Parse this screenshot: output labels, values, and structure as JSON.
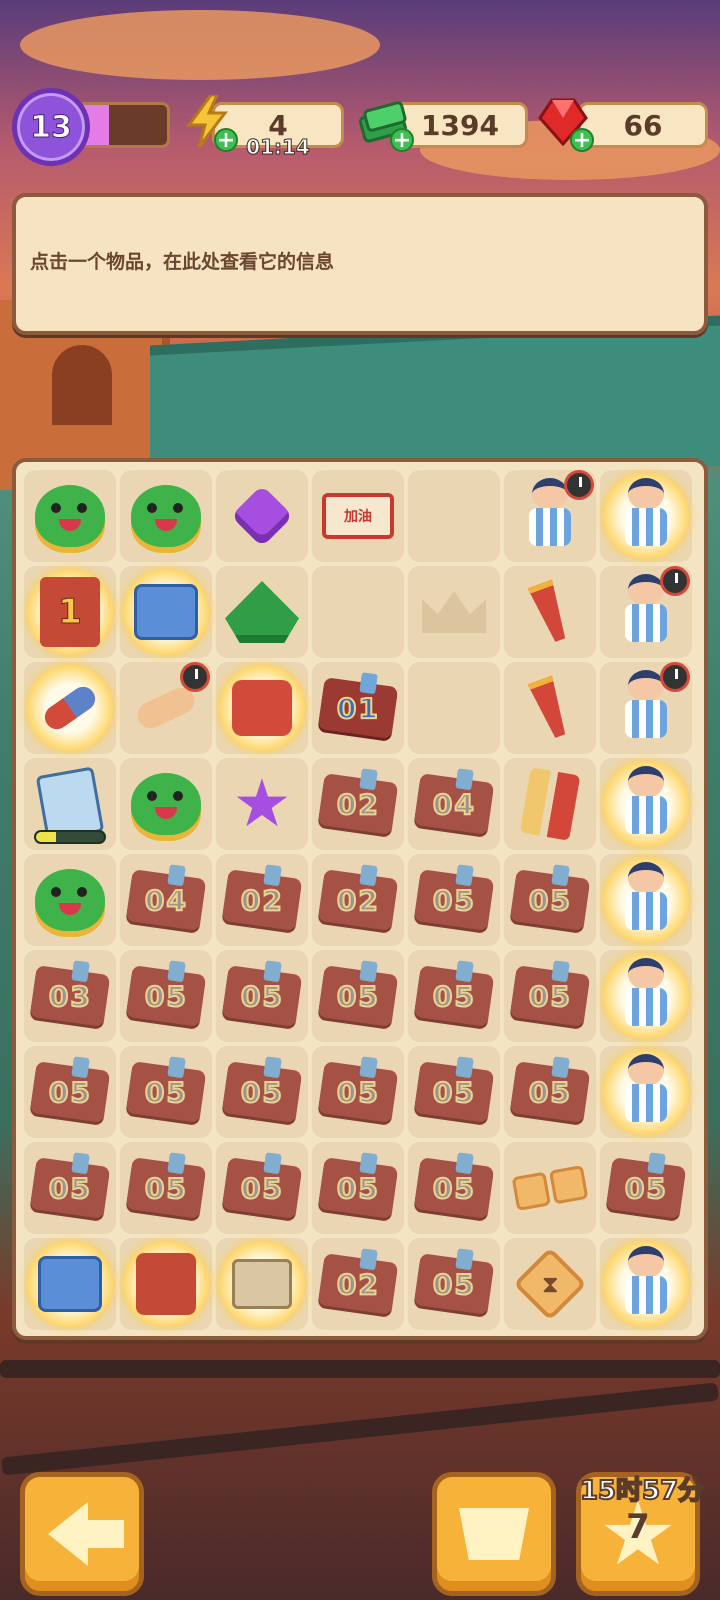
{
  "hud": {
    "level": "13",
    "xp_fill": 0.38,
    "energy": {
      "value": "4",
      "timer": "01:14",
      "icon": "lightning-icon"
    },
    "cash": {
      "value": "1394",
      "icon": "cash-stack-icon"
    },
    "gems": {
      "value": "66",
      "icon": "red-gem-icon"
    }
  },
  "info_panel": {
    "text": "点击一个物品，在此处查看它的信息"
  },
  "board": {
    "cells": [
      {
        "type": "monster-crown"
      },
      {
        "type": "monster-crown"
      },
      {
        "type": "purple-gem"
      },
      {
        "type": "scroll-banner",
        "label": "加油"
      },
      {
        "type": "empty"
      },
      {
        "type": "player-clock"
      },
      {
        "type": "player",
        "glow": true
      },
      {
        "type": "book",
        "label": "1",
        "glow": true
      },
      {
        "type": "chest",
        "glow": true
      },
      {
        "type": "cash-pile"
      },
      {
        "type": "empty"
      },
      {
        "type": "crown-placeholder"
      },
      {
        "type": "horn"
      },
      {
        "type": "player-clock"
      },
      {
        "type": "magnet",
        "glow": true
      },
      {
        "type": "bandage-clock"
      },
      {
        "type": "flag-monster",
        "glow": true
      },
      {
        "type": "ticket",
        "label": "01",
        "bright": true
      },
      {
        "type": "empty"
      },
      {
        "type": "horn"
      },
      {
        "type": "player-clock"
      },
      {
        "type": "paper-progress",
        "progress": 0.3
      },
      {
        "type": "monster-angel"
      },
      {
        "type": "star-slime"
      },
      {
        "type": "ticket",
        "label": "02"
      },
      {
        "type": "ticket",
        "label": "04"
      },
      {
        "type": "sticks"
      },
      {
        "type": "player",
        "glow": true
      },
      {
        "type": "monster-crown"
      },
      {
        "type": "ticket",
        "label": "04"
      },
      {
        "type": "ticket",
        "label": "02"
      },
      {
        "type": "ticket",
        "label": "02"
      },
      {
        "type": "ticket",
        "label": "05"
      },
      {
        "type": "ticket",
        "label": "05"
      },
      {
        "type": "player",
        "glow": true
      },
      {
        "type": "ticket",
        "label": "03"
      },
      {
        "type": "ticket",
        "label": "05"
      },
      {
        "type": "ticket",
        "label": "05"
      },
      {
        "type": "ticket",
        "label": "05"
      },
      {
        "type": "ticket",
        "label": "05"
      },
      {
        "type": "ticket",
        "label": "05"
      },
      {
        "type": "player",
        "glow": true
      },
      {
        "type": "ticket",
        "label": "05"
      },
      {
        "type": "ticket",
        "label": "05"
      },
      {
        "type": "ticket",
        "label": "05"
      },
      {
        "type": "ticket",
        "label": "05"
      },
      {
        "type": "ticket",
        "label": "05"
      },
      {
        "type": "ticket",
        "label": "05"
      },
      {
        "type": "player",
        "glow": true
      },
      {
        "type": "ticket",
        "label": "05"
      },
      {
        "type": "ticket",
        "label": "05"
      },
      {
        "type": "ticket",
        "label": "05"
      },
      {
        "type": "ticket",
        "label": "05"
      },
      {
        "type": "ticket",
        "label": "05"
      },
      {
        "type": "biscuits"
      },
      {
        "type": "ticket",
        "label": "05"
      },
      {
        "type": "chest",
        "glow": true
      },
      {
        "type": "redbook",
        "glow": true
      },
      {
        "type": "box-open",
        "glow": true
      },
      {
        "type": "ticket",
        "label": "02"
      },
      {
        "type": "ticket",
        "label": "05"
      },
      {
        "type": "hourglass-tile"
      },
      {
        "type": "player",
        "glow": true
      }
    ]
  },
  "bottom": {
    "back_icon": "arrow-left-icon",
    "basket_icon": "basket-icon",
    "star_timer": "15时57分",
    "star_count": "7"
  },
  "colors": {
    "accent": "#f7b23a",
    "panel": "#f6e3c2",
    "border": "#8c5a3c"
  }
}
